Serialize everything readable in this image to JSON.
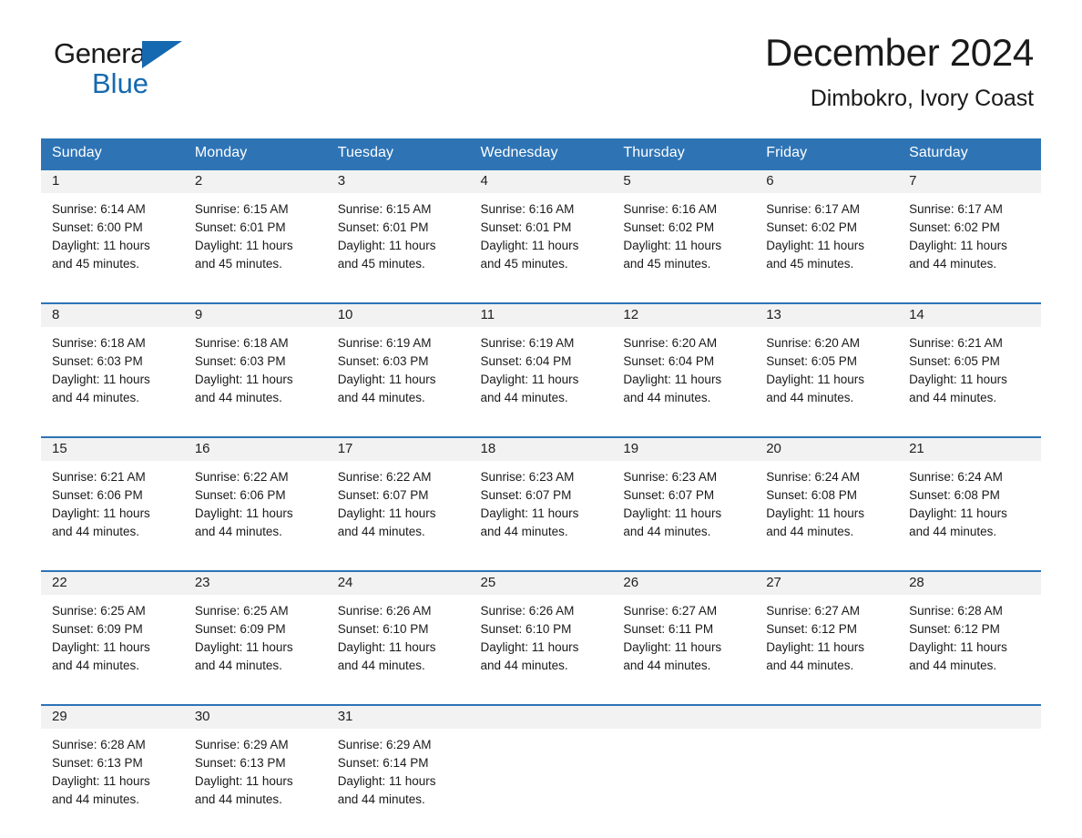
{
  "brand": {
    "name_top": "General",
    "name_bottom": "Blue",
    "accent_color": "#1569b0"
  },
  "header": {
    "title": "December 2024",
    "location": "Dimbokro, Ivory Coast"
  },
  "theme": {
    "header_blue": "#2e74b5",
    "daynum_gray": "#f2f2f2"
  },
  "weekday_headers": [
    "Sunday",
    "Monday",
    "Tuesday",
    "Wednesday",
    "Thursday",
    "Friday",
    "Saturday"
  ],
  "labels": {
    "sunrise_prefix": "Sunrise:",
    "sunset_prefix": "Sunset:",
    "daylight_prefix": "Daylight:"
  },
  "days": [
    {
      "date": "1",
      "sunrise": "Sunrise: 6:14 AM",
      "sunset": "Sunset: 6:00 PM",
      "daylight_line1": "Daylight: 11 hours",
      "daylight_line2": "and 45 minutes."
    },
    {
      "date": "2",
      "sunrise": "Sunrise: 6:15 AM",
      "sunset": "Sunset: 6:01 PM",
      "daylight_line1": "Daylight: 11 hours",
      "daylight_line2": "and 45 minutes."
    },
    {
      "date": "3",
      "sunrise": "Sunrise: 6:15 AM",
      "sunset": "Sunset: 6:01 PM",
      "daylight_line1": "Daylight: 11 hours",
      "daylight_line2": "and 45 minutes."
    },
    {
      "date": "4",
      "sunrise": "Sunrise: 6:16 AM",
      "sunset": "Sunset: 6:01 PM",
      "daylight_line1": "Daylight: 11 hours",
      "daylight_line2": "and 45 minutes."
    },
    {
      "date": "5",
      "sunrise": "Sunrise: 6:16 AM",
      "sunset": "Sunset: 6:02 PM",
      "daylight_line1": "Daylight: 11 hours",
      "daylight_line2": "and 45 minutes."
    },
    {
      "date": "6",
      "sunrise": "Sunrise: 6:17 AM",
      "sunset": "Sunset: 6:02 PM",
      "daylight_line1": "Daylight: 11 hours",
      "daylight_line2": "and 45 minutes."
    },
    {
      "date": "7",
      "sunrise": "Sunrise: 6:17 AM",
      "sunset": "Sunset: 6:02 PM",
      "daylight_line1": "Daylight: 11 hours",
      "daylight_line2": "and 44 minutes."
    },
    {
      "date": "8",
      "sunrise": "Sunrise: 6:18 AM",
      "sunset": "Sunset: 6:03 PM",
      "daylight_line1": "Daylight: 11 hours",
      "daylight_line2": "and 44 minutes."
    },
    {
      "date": "9",
      "sunrise": "Sunrise: 6:18 AM",
      "sunset": "Sunset: 6:03 PM",
      "daylight_line1": "Daylight: 11 hours",
      "daylight_line2": "and 44 minutes."
    },
    {
      "date": "10",
      "sunrise": "Sunrise: 6:19 AM",
      "sunset": "Sunset: 6:03 PM",
      "daylight_line1": "Daylight: 11 hours",
      "daylight_line2": "and 44 minutes."
    },
    {
      "date": "11",
      "sunrise": "Sunrise: 6:19 AM",
      "sunset": "Sunset: 6:04 PM",
      "daylight_line1": "Daylight: 11 hours",
      "daylight_line2": "and 44 minutes."
    },
    {
      "date": "12",
      "sunrise": "Sunrise: 6:20 AM",
      "sunset": "Sunset: 6:04 PM",
      "daylight_line1": "Daylight: 11 hours",
      "daylight_line2": "and 44 minutes."
    },
    {
      "date": "13",
      "sunrise": "Sunrise: 6:20 AM",
      "sunset": "Sunset: 6:05 PM",
      "daylight_line1": "Daylight: 11 hours",
      "daylight_line2": "and 44 minutes."
    },
    {
      "date": "14",
      "sunrise": "Sunrise: 6:21 AM",
      "sunset": "Sunset: 6:05 PM",
      "daylight_line1": "Daylight: 11 hours",
      "daylight_line2": "and 44 minutes."
    },
    {
      "date": "15",
      "sunrise": "Sunrise: 6:21 AM",
      "sunset": "Sunset: 6:06 PM",
      "daylight_line1": "Daylight: 11 hours",
      "daylight_line2": "and 44 minutes."
    },
    {
      "date": "16",
      "sunrise": "Sunrise: 6:22 AM",
      "sunset": "Sunset: 6:06 PM",
      "daylight_line1": "Daylight: 11 hours",
      "daylight_line2": "and 44 minutes."
    },
    {
      "date": "17",
      "sunrise": "Sunrise: 6:22 AM",
      "sunset": "Sunset: 6:07 PM",
      "daylight_line1": "Daylight: 11 hours",
      "daylight_line2": "and 44 minutes."
    },
    {
      "date": "18",
      "sunrise": "Sunrise: 6:23 AM",
      "sunset": "Sunset: 6:07 PM",
      "daylight_line1": "Daylight: 11 hours",
      "daylight_line2": "and 44 minutes."
    },
    {
      "date": "19",
      "sunrise": "Sunrise: 6:23 AM",
      "sunset": "Sunset: 6:07 PM",
      "daylight_line1": "Daylight: 11 hours",
      "daylight_line2": "and 44 minutes."
    },
    {
      "date": "20",
      "sunrise": "Sunrise: 6:24 AM",
      "sunset": "Sunset: 6:08 PM",
      "daylight_line1": "Daylight: 11 hours",
      "daylight_line2": "and 44 minutes."
    },
    {
      "date": "21",
      "sunrise": "Sunrise: 6:24 AM",
      "sunset": "Sunset: 6:08 PM",
      "daylight_line1": "Daylight: 11 hours",
      "daylight_line2": "and 44 minutes."
    },
    {
      "date": "22",
      "sunrise": "Sunrise: 6:25 AM",
      "sunset": "Sunset: 6:09 PM",
      "daylight_line1": "Daylight: 11 hours",
      "daylight_line2": "and 44 minutes."
    },
    {
      "date": "23",
      "sunrise": "Sunrise: 6:25 AM",
      "sunset": "Sunset: 6:09 PM",
      "daylight_line1": "Daylight: 11 hours",
      "daylight_line2": "and 44 minutes."
    },
    {
      "date": "24",
      "sunrise": "Sunrise: 6:26 AM",
      "sunset": "Sunset: 6:10 PM",
      "daylight_line1": "Daylight: 11 hours",
      "daylight_line2": "and 44 minutes."
    },
    {
      "date": "25",
      "sunrise": "Sunrise: 6:26 AM",
      "sunset": "Sunset: 6:10 PM",
      "daylight_line1": "Daylight: 11 hours",
      "daylight_line2": "and 44 minutes."
    },
    {
      "date": "26",
      "sunrise": "Sunrise: 6:27 AM",
      "sunset": "Sunset: 6:11 PM",
      "daylight_line1": "Daylight: 11 hours",
      "daylight_line2": "and 44 minutes."
    },
    {
      "date": "27",
      "sunrise": "Sunrise: 6:27 AM",
      "sunset": "Sunset: 6:12 PM",
      "daylight_line1": "Daylight: 11 hours",
      "daylight_line2": "and 44 minutes."
    },
    {
      "date": "28",
      "sunrise": "Sunrise: 6:28 AM",
      "sunset": "Sunset: 6:12 PM",
      "daylight_line1": "Daylight: 11 hours",
      "daylight_line2": "and 44 minutes."
    },
    {
      "date": "29",
      "sunrise": "Sunrise: 6:28 AM",
      "sunset": "Sunset: 6:13 PM",
      "daylight_line1": "Daylight: 11 hours",
      "daylight_line2": "and 44 minutes."
    },
    {
      "date": "30",
      "sunrise": "Sunrise: 6:29 AM",
      "sunset": "Sunset: 6:13 PM",
      "daylight_line1": "Daylight: 11 hours",
      "daylight_line2": "and 44 minutes."
    },
    {
      "date": "31",
      "sunrise": "Sunrise: 6:29 AM",
      "sunset": "Sunset: 6:14 PM",
      "daylight_line1": "Daylight: 11 hours",
      "daylight_line2": "and 44 minutes."
    }
  ],
  "grid": {
    "first_weekday_index": 0,
    "weeks": 5
  }
}
